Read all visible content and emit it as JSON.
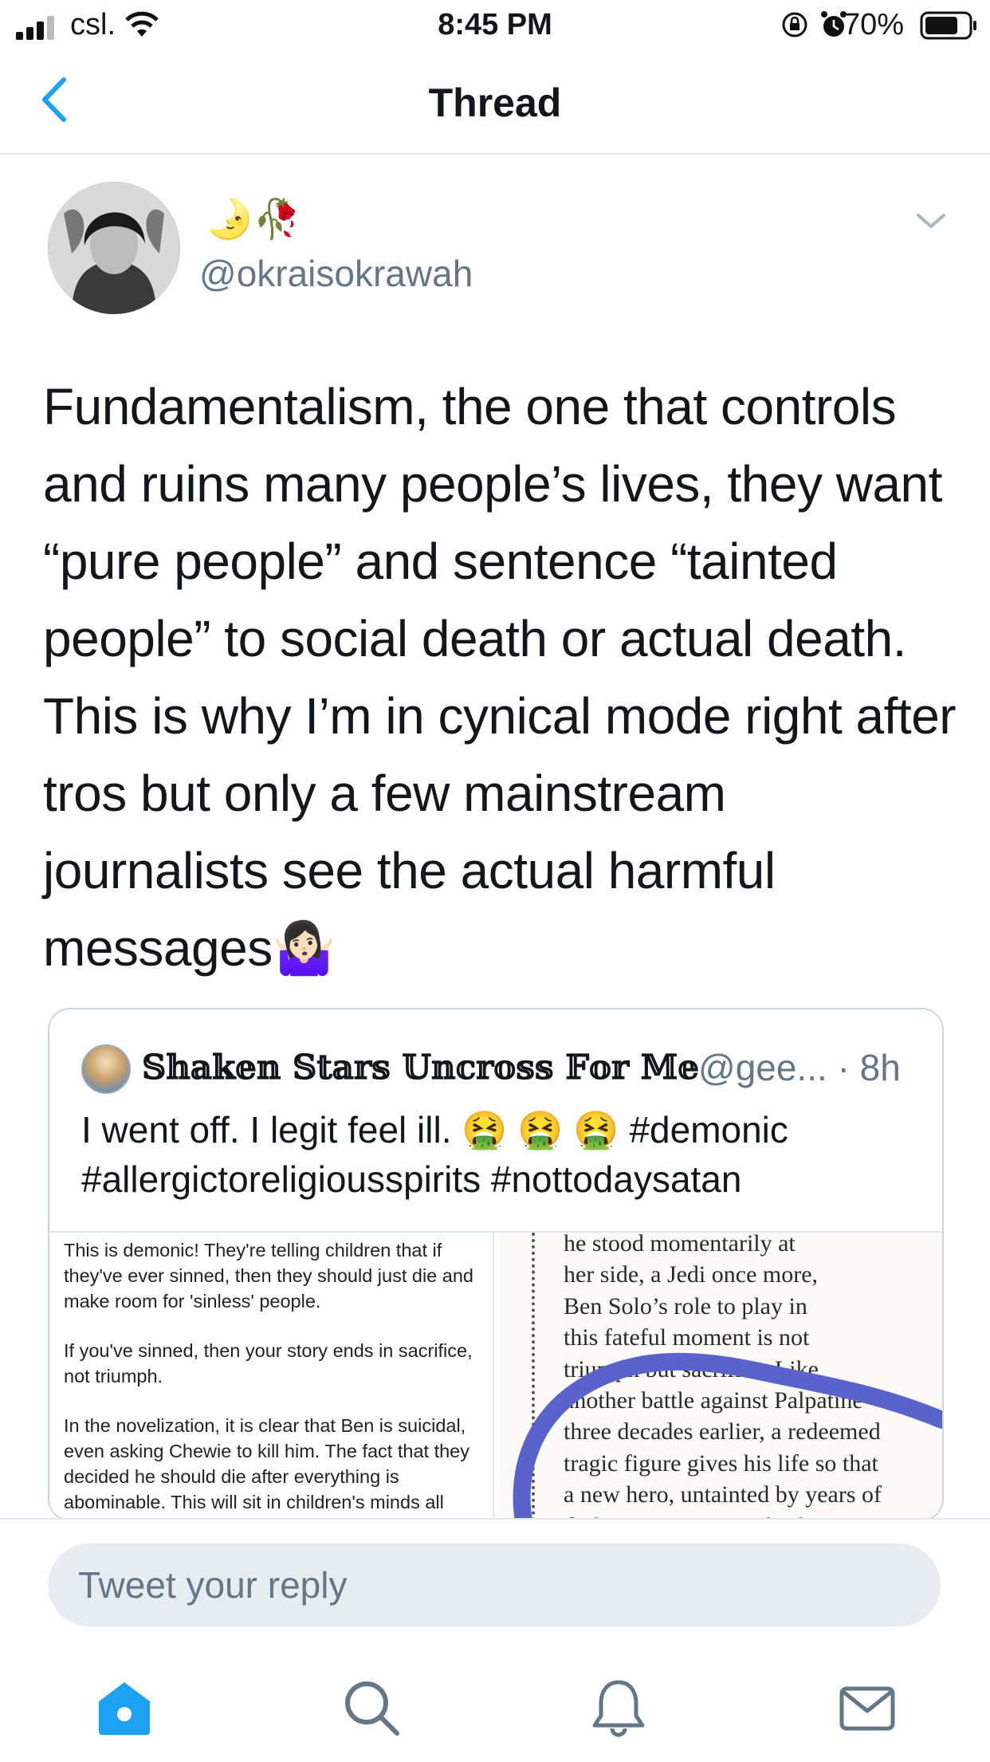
{
  "status_bar": {
    "carrier": "csl.",
    "time": "8:45 PM",
    "battery": "70%"
  },
  "nav": {
    "title": "Thread"
  },
  "tweet": {
    "display_name": "🌛🥀",
    "handle": "@okraisokrawah",
    "text": "Fundamentalism, the one that controls and ruins many people’s lives, they want “pure people” and sentence “tainted people” to social death or actual death. This is why I’m in cynical mode right after tros but only a few mainstream journalists see the actual harmful messages🤷🏻‍♀️"
  },
  "quote": {
    "name": "𝕊𝕙𝕒𝕜𝕖𝕟 𝕊𝕥𝕒𝕣𝕤 𝕌𝕟𝕔𝕣𝕠𝕤𝕤 𝔽𝕠𝕣 𝕄𝕖",
    "handle_time": "@gee... · 8h",
    "text": "I went off. I legit feel ill. 🤮 🤮 🤮 #demonic #allergictoreligiousspirits #nottodaysatan",
    "media_left": {
      "p1": "This is demonic! They're telling children that if they've ever sinned, then they should just die and make room for 'sinless' people.",
      "p2": "If you've sinned, then your story ends in sacrifice, not triumph.",
      "p3": "In the novelization, it is clear that Ben is suicidal, even asking Chewie to kill him. The fact that they decided he should die after everything is abominable. This will sit in children's minds all their lifes as their"
    },
    "media_right": {
      "lines": [
        "he stood momentarily at",
        "her side, a Jedi once more,",
        "Ben Solo’s role to play in",
        "this fateful moment is not",
        "triumph but sacrifice. Like",
        "another battle against Palpatine",
        "three decades earlier, a redeemed",
        "tragic figure gives his life so that",
        "a new hero, untainted by years of",
        "darkness, may prevail. This time"
      ]
    }
  },
  "reply": {
    "placeholder": "Tweet your reply"
  },
  "tabs": [
    {
      "icon": "home-icon",
      "active": true
    },
    {
      "icon": "search-icon",
      "active": false
    },
    {
      "icon": "bell-icon",
      "active": false
    },
    {
      "icon": "mail-icon",
      "active": false
    }
  ],
  "colors": {
    "accent": "#1da1f2",
    "secondary_text": "#657786",
    "border": "#e1e8ed",
    "ink_circle": "#5a63cc"
  }
}
